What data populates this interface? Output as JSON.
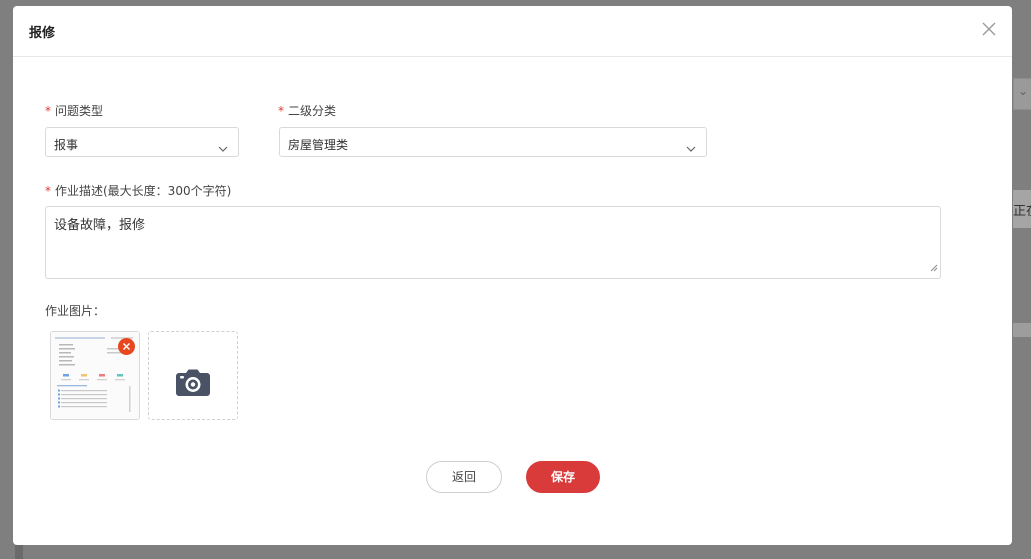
{
  "modal": {
    "title": "报修",
    "close_icon": "close-icon"
  },
  "form": {
    "problem_type": {
      "required_mark": "*",
      "label": "问题类型",
      "value": "报事"
    },
    "secondary_category": {
      "required_mark": "*",
      "label": "二级分类",
      "value": "房屋管理类"
    },
    "description": {
      "required_mark": "*",
      "label": "作业描述(最大长度：300个字符)",
      "value": "设备故障，报修"
    },
    "images": {
      "label": "作业图片：",
      "upload_icon": "camera-icon",
      "remove_icon": "remove-icon"
    }
  },
  "buttons": {
    "back": "返回",
    "save": "保存"
  },
  "background": {
    "partial_text": "正在"
  },
  "colors": {
    "accent": "#d93a3a",
    "required": "#e03a3a",
    "remove_badge": "#e8481f"
  }
}
